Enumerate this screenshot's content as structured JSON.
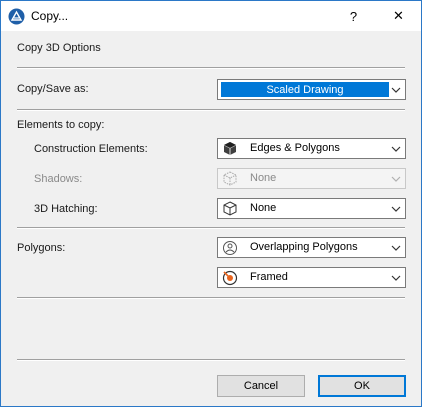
{
  "window": {
    "title": "Copy...",
    "help_label": "?",
    "close_label": "✕"
  },
  "section_title": "Copy 3D Options",
  "copy_save": {
    "label": "Copy/Save as:",
    "value": "Scaled Drawing"
  },
  "elements_header": "Elements to copy:",
  "construction": {
    "label": "Construction Elements:",
    "value": "Edges & Polygons",
    "icon": "solid-cube-icon"
  },
  "shadows": {
    "label": "Shadows:",
    "value": "None",
    "icon": "wireframe-cube-icon",
    "disabled": true
  },
  "hatching": {
    "label": "3D Hatching:",
    "value": "None",
    "icon": "wireframe-cube-icon"
  },
  "polygons": {
    "label": "Polygons:",
    "value": "Overlapping Polygons",
    "icon": "overlap-polygon-icon"
  },
  "framing": {
    "value": "Framed",
    "icon": "framed-target-icon"
  },
  "buttons": {
    "cancel": "Cancel",
    "ok": "OK"
  },
  "colors": {
    "accent": "#0078d7",
    "framed_icon": "#e8641e"
  }
}
